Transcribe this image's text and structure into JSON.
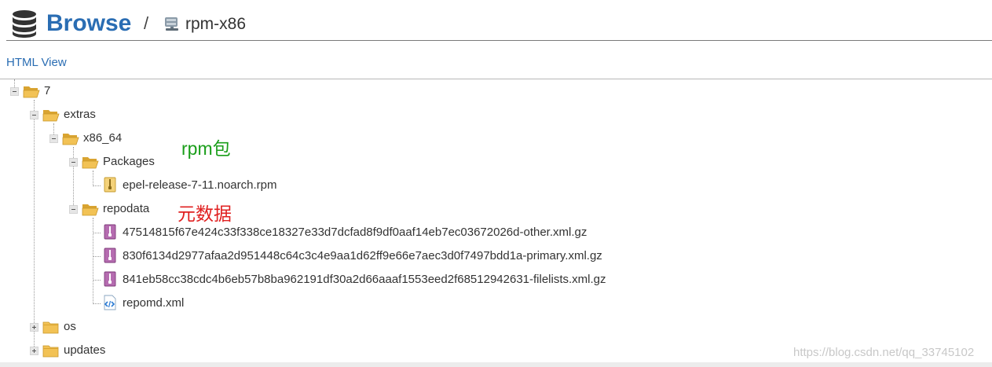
{
  "header": {
    "title": "Browse",
    "separator": "/",
    "repository": "rpm-x86",
    "icon": "database-icon",
    "repository_icon": "repository-icon"
  },
  "toolbar": {
    "html_view_link": "HTML View"
  },
  "tree": {
    "root": {
      "label": "7",
      "state": "expanded"
    },
    "extras": {
      "label": "extras",
      "state": "expanded"
    },
    "x86_64": {
      "label": "x86_64",
      "state": "expanded"
    },
    "packages": {
      "label": "Packages",
      "state": "expanded"
    },
    "epel_rpm": {
      "label": "epel-release-7-11.noarch.rpm",
      "type": "rpm-file"
    },
    "repodata": {
      "label": "repodata",
      "state": "expanded"
    },
    "other_xml": {
      "label": "47514815f67e424c33f338ce18327e33d7dcfad8f9df0aaf14eb7ec03672026d-other.xml.gz",
      "type": "archive-file"
    },
    "primary_xml": {
      "label": "830f6134d2977afaa2d951448c64c3c4e9aa1d62ff9e66e7aec3d0f7497bdd1a-primary.xml.gz",
      "type": "archive-file"
    },
    "filelists_xml": {
      "label": "841eb58cc38cdc4b6eb57b8ba962191df30a2d66aaaf1553eed2f68512942631-filelists.xml.gz",
      "type": "archive-file"
    },
    "repomd": {
      "label": "repomd.xml",
      "type": "xml-file"
    },
    "os": {
      "label": "os",
      "state": "collapsed"
    },
    "updates": {
      "label": "updates",
      "state": "collapsed"
    }
  },
  "annotations": {
    "rpm_label": "rpm包",
    "metadata_label": "元数据"
  },
  "watermark": "https://blog.csdn.net/qq_33745102",
  "colors": {
    "accent": "#2a6db3",
    "annotation_green": "#1a9e1a",
    "annotation_red": "#e02020",
    "folder_yellow": "#f2c255",
    "archive_purple": "#9a4a96"
  }
}
